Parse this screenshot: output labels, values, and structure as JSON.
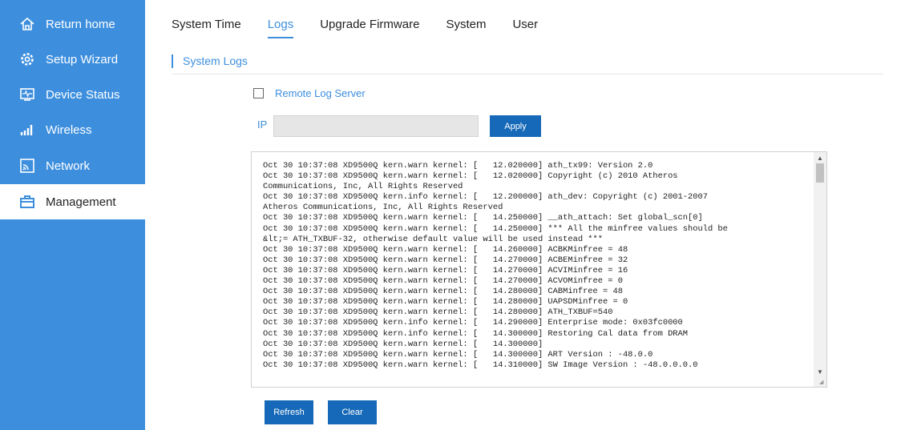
{
  "sidebar": {
    "items": [
      {
        "label": "Return home",
        "icon": "home-icon"
      },
      {
        "label": "Setup Wizard",
        "icon": "wizard-gear-icon"
      },
      {
        "label": "Device Status",
        "icon": "monitor-pulse-icon"
      },
      {
        "label": "Wireless",
        "icon": "signal-bars-icon"
      },
      {
        "label": "Network",
        "icon": "network-icon"
      },
      {
        "label": "Management",
        "icon": "briefcase-icon",
        "active": true
      }
    ]
  },
  "tabs": [
    {
      "label": "System Time"
    },
    {
      "label": "Logs",
      "active": true
    },
    {
      "label": "Upgrade Firmware"
    },
    {
      "label": "System"
    },
    {
      "label": "User"
    }
  ],
  "section": {
    "title": "System Logs"
  },
  "remote_log": {
    "label": "Remote Log Server",
    "checked": false
  },
  "ip": {
    "label": "IP",
    "value": "",
    "placeholder": ""
  },
  "buttons": {
    "apply": "Apply",
    "refresh": "Refresh",
    "clear": "Clear"
  },
  "log_text": "Oct 30 10:37:08 XD9500Q kern.warn kernel: [   12.020000] ath_tx99: Version 2.0\nOct 30 10:37:08 XD9500Q kern.warn kernel: [   12.020000] Copyright (c) 2010 Atheros\nCommunications, Inc, All Rights Reserved\nOct 30 10:37:08 XD9500Q kern.info kernel: [   12.200000] ath_dev: Copyright (c) 2001-2007\nAtheros Communications, Inc, All Rights Reserved\nOct 30 10:37:08 XD9500Q kern.warn kernel: [   14.250000] __ath_attach: Set global_scn[0]\nOct 30 10:37:08 XD9500Q kern.warn kernel: [   14.250000] *** All the minfree values should be\n&lt;= ATH_TXBUF-32, otherwise default value will be used instead ***\nOct 30 10:37:08 XD9500Q kern.warn kernel: [   14.260000] ACBKMinfree = 48\nOct 30 10:37:08 XD9500Q kern.warn kernel: [   14.270000] ACBEMinfree = 32\nOct 30 10:37:08 XD9500Q kern.warn kernel: [   14.270000] ACVIMinfree = 16\nOct 30 10:37:08 XD9500Q kern.warn kernel: [   14.270000] ACVOMinfree = 0\nOct 30 10:37:08 XD9500Q kern.warn kernel: [   14.280000] CABMinfree = 48\nOct 30 10:37:08 XD9500Q kern.warn kernel: [   14.280000] UAPSDMinfree = 0\nOct 30 10:37:08 XD9500Q kern.warn kernel: [   14.280000] ATH_TXBUF=540\nOct 30 10:37:08 XD9500Q kern.info kernel: [   14.290000] Enterprise mode: 0x03fc0000\nOct 30 10:37:08 XD9500Q kern.info kernel: [   14.300000] Restoring Cal data from DRAM\nOct 30 10:37:08 XD9500Q kern.warn kernel: [   14.300000]\nOct 30 10:37:08 XD9500Q kern.warn kernel: [   14.300000] ART Version : -48.0.0\nOct 30 10:37:08 XD9500Q kern.warn kernel: [   14.310000] SW Image Version : -48.0.0.0.0",
  "colors": {
    "accent": "#3d8fde",
    "button": "#1669b8",
    "sidebar_bg": "#3d8fde"
  }
}
